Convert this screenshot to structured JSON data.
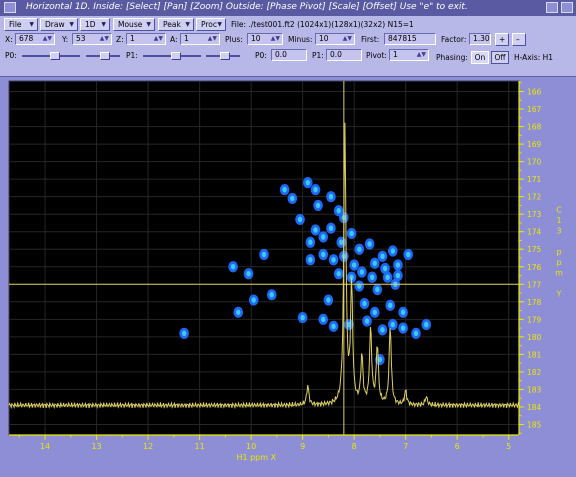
{
  "window": {
    "title": "Horizontal 1D.   Inside: [Select] [Pan] [Zoom]  Outside: [Phase Pivot] [Scale] [Offset]  Use \"e\" to exit."
  },
  "toolbar": {
    "file_menu": "File",
    "draw_menu": "Draw",
    "oned_menu": "1D",
    "mouse_menu": "Mouse",
    "peak_menu": "Peak",
    "proc_menu": "Proc",
    "file_info": "File: ./test001.ft2 (1024x1)(128x1)(32x2) N15=1",
    "x_label": "X:",
    "x_value": "678",
    "y_label": "Y:",
    "y_value": "53",
    "z_label": "Z:",
    "z_value": "1",
    "a_label": "A:",
    "a_value": "1",
    "plus_label": "Plus:",
    "plus_value": "10",
    "minus_label": "Minus:",
    "minus_value": "10",
    "first_label": "First:",
    "first_value": "847815",
    "factor_label": "Factor:",
    "factor_value": "1.30",
    "plus_btn": "+",
    "minus_btn": "–",
    "p0_label": "P0:",
    "p1_label": "P1:",
    "p0_value_label": "P0:",
    "p0_value": "0.0",
    "p1_value_label": "P1:",
    "p1_value": "0.0",
    "pivot_label": "Pivot:",
    "pivot_value": "1",
    "phasing_label": "Phasing:",
    "phasing_on": "On",
    "phasing_off": "Off",
    "haxis_label": "H-Axis: H1"
  },
  "chart_data": {
    "type": "scatter",
    "x_axis": {
      "label": "H1 ppm X",
      "range": [
        14.7,
        4.8
      ],
      "ticks": [
        14,
        13,
        12,
        11,
        10,
        9,
        8,
        7,
        6,
        5
      ]
    },
    "y_axis": {
      "label_chars": [
        "C",
        "1",
        "3",
        "",
        "p",
        "p",
        "m",
        "",
        "Y"
      ],
      "range": [
        165.4,
        185.6
      ],
      "ticks": [
        166,
        167,
        168,
        169,
        170,
        171,
        172,
        173,
        174,
        175,
        176,
        177,
        178,
        179,
        180,
        181,
        182,
        183,
        184,
        185
      ]
    },
    "crosshair": {
      "x": 8.2,
      "y": 177.0
    },
    "colors": {
      "background": "#000000",
      "axis": "#e8e800",
      "trace": "#e0d060",
      "contour": "#1e6fff",
      "contour_core": "#3ec8ff",
      "gridline": "#262626"
    },
    "peaks": [
      [
        9.35,
        171.6
      ],
      [
        9.2,
        172.1
      ],
      [
        9.05,
        173.3
      ],
      [
        8.9,
        171.2
      ],
      [
        8.75,
        171.6
      ],
      [
        8.7,
        172.5
      ],
      [
        8.45,
        172.0
      ],
      [
        8.3,
        172.8
      ],
      [
        8.2,
        173.2
      ],
      [
        8.75,
        173.9
      ],
      [
        8.6,
        174.3
      ],
      [
        8.45,
        173.8
      ],
      [
        8.85,
        174.6
      ],
      [
        8.25,
        174.6
      ],
      [
        8.05,
        174.1
      ],
      [
        7.9,
        175.0
      ],
      [
        7.7,
        174.7
      ],
      [
        7.45,
        175.4
      ],
      [
        7.25,
        175.1
      ],
      [
        8.85,
        175.6
      ],
      [
        8.6,
        175.3
      ],
      [
        8.4,
        175.6
      ],
      [
        8.2,
        175.4
      ],
      [
        8.0,
        175.9
      ],
      [
        7.85,
        176.3
      ],
      [
        7.6,
        175.8
      ],
      [
        7.4,
        176.1
      ],
      [
        7.15,
        175.9
      ],
      [
        6.95,
        175.3
      ],
      [
        8.3,
        176.4
      ],
      [
        8.05,
        176.6
      ],
      [
        7.65,
        176.6
      ],
      [
        7.35,
        176.6
      ],
      [
        7.15,
        176.5
      ],
      [
        7.9,
        177.1
      ],
      [
        7.55,
        177.3
      ],
      [
        7.2,
        177.0
      ],
      [
        8.5,
        177.9
      ],
      [
        7.8,
        178.1
      ],
      [
        7.6,
        178.6
      ],
      [
        7.3,
        178.2
      ],
      [
        7.05,
        178.6
      ],
      [
        8.6,
        179.0
      ],
      [
        8.4,
        179.4
      ],
      [
        8.1,
        179.3
      ],
      [
        7.75,
        179.1
      ],
      [
        7.45,
        179.6
      ],
      [
        7.25,
        179.3
      ],
      [
        7.05,
        179.5
      ],
      [
        6.8,
        179.8
      ],
      [
        6.6,
        179.3
      ],
      [
        9.75,
        175.3
      ],
      [
        10.05,
        176.4
      ],
      [
        9.95,
        177.9
      ],
      [
        10.35,
        176.0
      ],
      [
        10.25,
        178.6
      ],
      [
        9.6,
        177.6
      ],
      [
        11.3,
        179.8
      ],
      [
        9.0,
        178.9
      ],
      [
        7.5,
        181.3
      ]
    ],
    "trace_peaks": [
      [
        8.18,
        1.0
      ],
      [
        8.05,
        0.42
      ],
      [
        7.85,
        0.17
      ],
      [
        7.68,
        0.27
      ],
      [
        7.55,
        0.21
      ],
      [
        7.3,
        0.28
      ],
      [
        8.9,
        0.07
      ],
      [
        7.0,
        0.05
      ],
      [
        6.6,
        0.03
      ]
    ]
  }
}
